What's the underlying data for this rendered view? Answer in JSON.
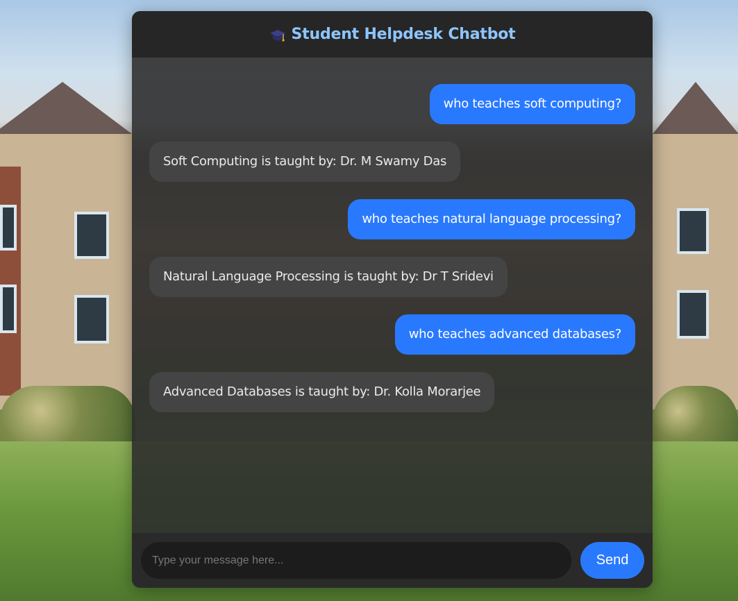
{
  "header": {
    "icon": "graduation-cap-icon",
    "title": "Student Helpdesk Chatbot"
  },
  "messages": [
    {
      "role": "user",
      "text": "who teaches soft computing?"
    },
    {
      "role": "bot",
      "text": "Soft Computing is taught by: Dr. M Swamy Das"
    },
    {
      "role": "user",
      "text": "who teaches natural language processing?"
    },
    {
      "role": "bot",
      "text": "Natural Language Processing is taught by: Dr T Sridevi"
    },
    {
      "role": "user",
      "text": "who teaches advanced databases?"
    },
    {
      "role": "bot",
      "text": "Advanced Databases is taught by: Dr. Kolla Morarjee"
    }
  ],
  "input": {
    "placeholder": "Type your message here...",
    "value": ""
  },
  "send_label": "Send",
  "colors": {
    "accent": "#2979ff",
    "title": "#8ec5ff",
    "bot_bubble": "#444444"
  }
}
